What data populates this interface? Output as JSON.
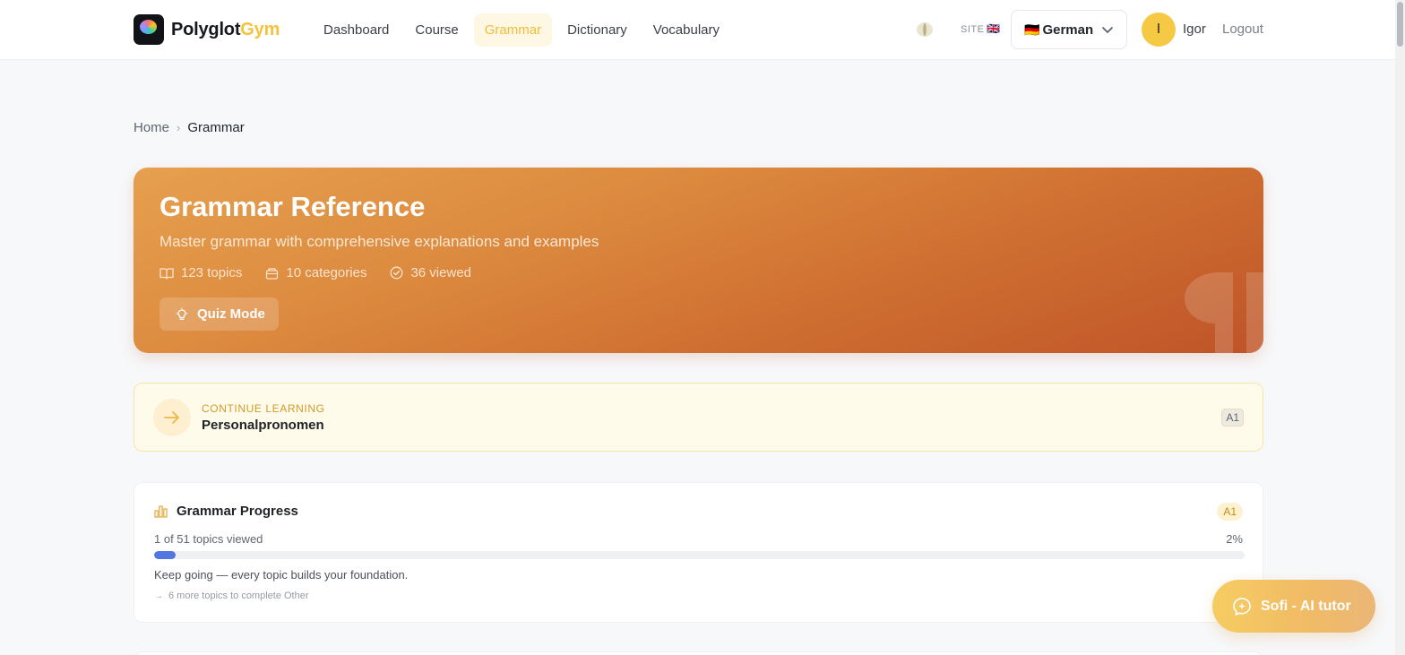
{
  "header": {
    "brand_part1": "Polyglot",
    "brand_part2": "Gym",
    "nav": [
      {
        "label": "Dashboard",
        "active": false
      },
      {
        "label": "Course",
        "active": false
      },
      {
        "label": "Grammar",
        "active": true
      },
      {
        "label": "Dictionary",
        "active": false
      },
      {
        "label": "Vocabulary",
        "active": false
      }
    ],
    "site_label": "SITE",
    "site_flag": "🇬🇧",
    "language": {
      "flag": "🇩🇪",
      "name": "German"
    },
    "avatar_initial": "I",
    "user_name": "Igor",
    "logout_label": "Logout"
  },
  "breadcrumb": {
    "home": "Home",
    "separator": "›",
    "current": "Grammar"
  },
  "hero": {
    "title": "Grammar Reference",
    "subtitle": "Master grammar with comprehensive explanations and examples",
    "stats": {
      "topics": "123 topics",
      "categories": "10 categories",
      "viewed": "36 viewed"
    },
    "quiz_label": "Quiz Mode"
  },
  "continue": {
    "label": "CONTINUE LEARNING",
    "topic": "Personalpronomen",
    "level": "A1"
  },
  "progress": {
    "title": "Grammar Progress",
    "level": "A1",
    "count_text": "1 of 51 topics viewed",
    "percent_text": "2%",
    "percent_value": 2,
    "message": "Keep going — every topic builds your foundation.",
    "hint": "6 more topics to complete Other"
  },
  "tutor": {
    "label": "Sofi - AI tutor"
  },
  "colors": {
    "accent": "#f2bd37",
    "hero_start": "#e6a04e",
    "hero_end": "#bf5428",
    "progress_fill": "#5277e0"
  },
  "icons": {
    "theme": "theme-toggle-icon",
    "chevron": "chevron-down-icon",
    "book": "book-icon",
    "folder": "folder-icon",
    "check": "check-circle-icon",
    "bulb": "lightbulb-icon",
    "arrow": "arrow-right-icon",
    "chart": "bar-chart-icon",
    "chat": "chat-sparkle-icon"
  }
}
